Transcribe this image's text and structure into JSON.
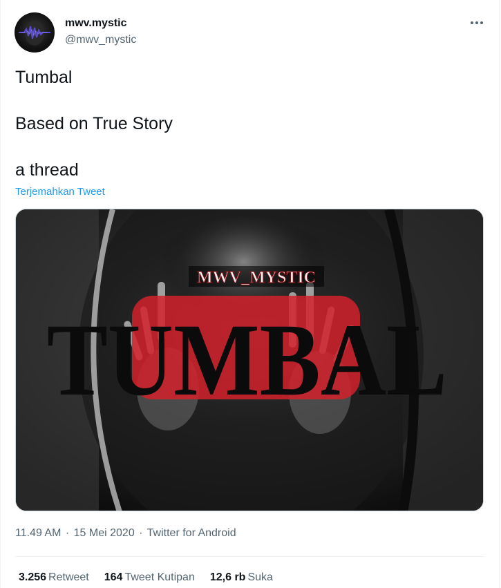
{
  "author": {
    "display_name": "mwv.mystic",
    "handle": "@mwv_mystic"
  },
  "tweet": {
    "lines": [
      "Tumbal",
      "Based on True Story",
      "a thread"
    ],
    "translate_label": "Terjemahkan Tweet"
  },
  "media": {
    "watermark_text": "MWV_MYSTIC",
    "title_text": "TUMBAL"
  },
  "meta": {
    "time": "11.49 AM",
    "date": "15 Mei 2020",
    "source": "Twitter for Android",
    "separator": "·"
  },
  "stats": {
    "retweets": {
      "count": "3.256",
      "label": "Retweet"
    },
    "quotes": {
      "count": "164",
      "label": "Tweet Kutipan"
    },
    "likes": {
      "count": "12,6 rb",
      "label": "Suka"
    }
  },
  "icons": {
    "more": "more-horizontal-icon",
    "avatar": "soundwave-avatar"
  },
  "colors": {
    "link": "#1d9bf0",
    "muted": "#536471",
    "text": "#0f1419"
  }
}
